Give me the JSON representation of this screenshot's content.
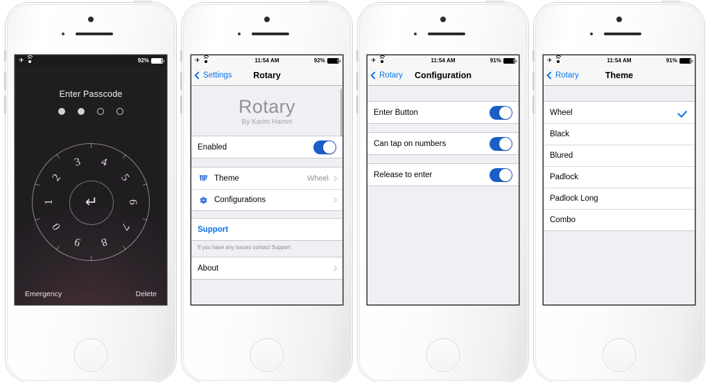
{
  "phones": [
    {
      "id": "lockscreen",
      "statusbar": {
        "theme": "dark",
        "airplane_icon": "airplane-icon",
        "wifi_icon": "wifi-icon",
        "battery_percent": "92%",
        "battery_icon": "battery-icon",
        "time": ""
      },
      "lock": {
        "title": "Enter Passcode",
        "dots": [
          "filled",
          "filled",
          "empty",
          "empty"
        ],
        "dial_numbers": [
          "0",
          "1",
          "2",
          "3",
          "4",
          "5",
          "6",
          "7",
          "8",
          "9"
        ],
        "enter_icon": "enter-arrow-icon",
        "emergency_label": "Emergency",
        "delete_label": "Delete"
      }
    },
    {
      "id": "rotary-settings",
      "statusbar": {
        "theme": "light",
        "airplane_icon": "airplane-icon",
        "wifi_icon": "wifi-icon",
        "time": "11:54 AM",
        "battery_percent": "92%",
        "battery_icon": "battery-icon"
      },
      "navbar": {
        "back_label": "Settings",
        "title": "Rotary"
      },
      "app_header": {
        "name": "Rotary",
        "author": "By Karim Hamm"
      },
      "rows": {
        "enabled_label": "Enabled",
        "theme_label": "Theme",
        "theme_value": "Wheel",
        "theme_icon": "fan-wheel-icon",
        "configurations_label": "Configurations",
        "configurations_icon": "gear-icon",
        "support_label": "Support",
        "support_footnote": "If you have any issues contact Support",
        "about_label": "About"
      }
    },
    {
      "id": "configuration",
      "statusbar": {
        "theme": "light",
        "airplane_icon": "airplane-icon",
        "wifi_icon": "wifi-icon",
        "time": "11:54 AM",
        "battery_percent": "91%",
        "battery_icon": "battery-icon"
      },
      "navbar": {
        "back_label": "Rotary",
        "title": "Configuration"
      },
      "switches": [
        {
          "label": "Enter Button",
          "on": true
        },
        {
          "label": "Can tap on numbers",
          "on": true
        },
        {
          "label": "Release to enter",
          "on": true
        }
      ]
    },
    {
      "id": "theme",
      "statusbar": {
        "theme": "light",
        "airplane_icon": "airplane-icon",
        "wifi_icon": "wifi-icon",
        "time": "11:54 AM",
        "battery_percent": "91%",
        "battery_icon": "battery-icon"
      },
      "navbar": {
        "back_label": "Rotary",
        "title": "Theme"
      },
      "options": [
        {
          "label": "Wheel",
          "selected": true
        },
        {
          "label": "Black",
          "selected": false
        },
        {
          "label": "Blured",
          "selected": false
        },
        {
          "label": "Padlock",
          "selected": false
        },
        {
          "label": "Padlock Long",
          "selected": false
        },
        {
          "label": "Combo",
          "selected": false
        }
      ],
      "check_icon": "checkmark-icon"
    }
  ],
  "colors": {
    "accent_blue": "#0a72e8",
    "switch_on": "#1a5fc8",
    "table_bg": "#eff0f3",
    "separator": "#c8c7cc",
    "secondary_text": "#8e8e93"
  }
}
